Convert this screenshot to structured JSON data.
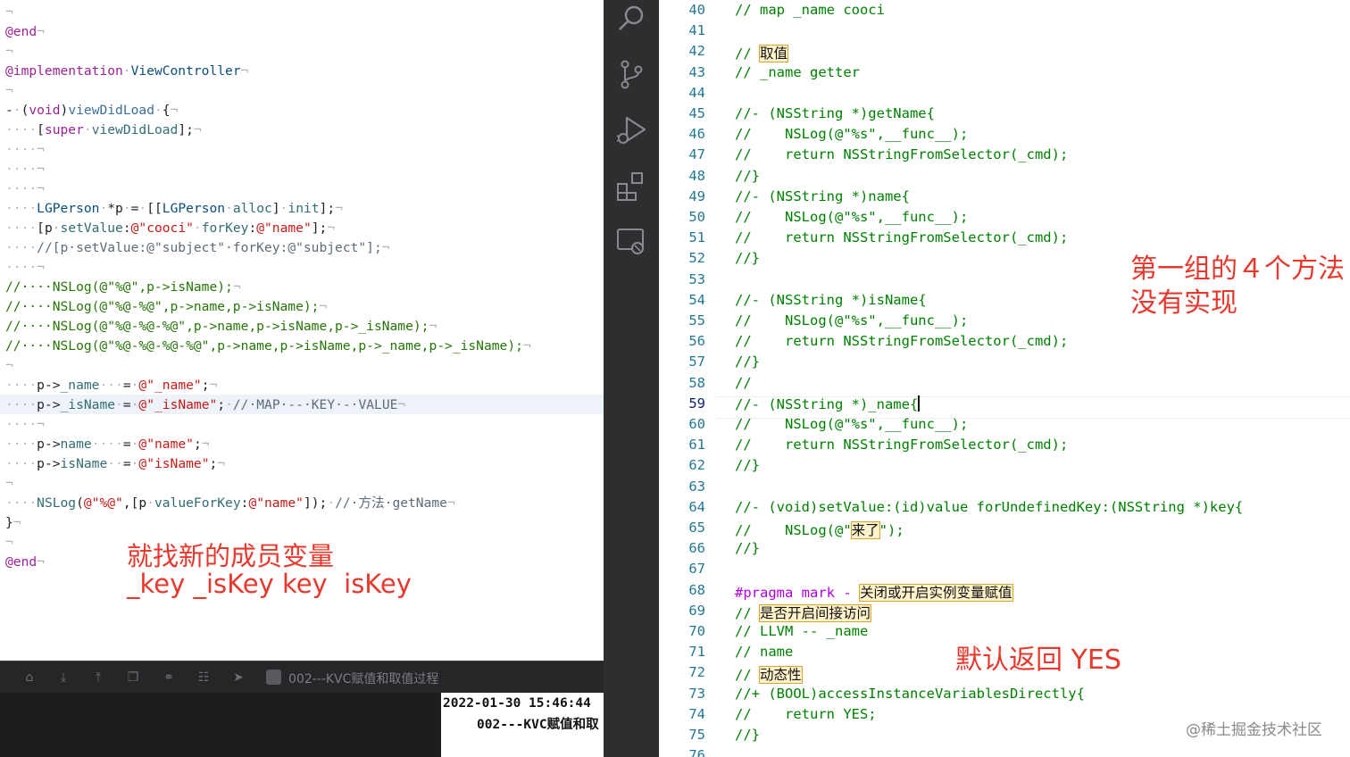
{
  "left_editor": {
    "lines": [
      {
        "segments": [
          {
            "t": "¬",
            "c": "t-inv"
          }
        ]
      },
      {
        "segments": [
          {
            "t": "@end",
            "c": "t-kw"
          },
          {
            "t": "¬",
            "c": "t-inv"
          }
        ]
      },
      {
        "segments": [
          {
            "t": "¬",
            "c": "t-inv"
          }
        ]
      },
      {
        "segments": [
          {
            "t": "@implementation",
            "c": "t-kw"
          },
          {
            "t": "·",
            "c": "t-inv"
          },
          {
            "t": "ViewController",
            "c": "t-ty"
          },
          {
            "t": "¬",
            "c": "t-inv"
          }
        ]
      },
      {
        "segments": [
          {
            "t": "¬",
            "c": "t-inv"
          }
        ]
      },
      {
        "segments": [
          {
            "t": "-",
            "c": ""
          },
          {
            "t": "·",
            "c": "t-inv"
          },
          {
            "t": "(",
            "c": ""
          },
          {
            "t": "void",
            "c": "t-kw"
          },
          {
            "t": ")",
            "c": ""
          },
          {
            "t": "viewDidLoad",
            "c": "t-fn"
          },
          {
            "t": "·",
            "c": "t-inv"
          },
          {
            "t": "{",
            "c": ""
          },
          {
            "t": "¬",
            "c": "t-inv"
          }
        ]
      },
      {
        "segments": [
          {
            "t": "····",
            "c": "t-inv"
          },
          {
            "t": "[",
            "c": ""
          },
          {
            "t": "super",
            "c": "t-kw"
          },
          {
            "t": "·",
            "c": "t-inv"
          },
          {
            "t": "viewDidLoad",
            "c": "t-ac"
          },
          {
            "t": "];",
            "c": ""
          },
          {
            "t": "¬",
            "c": "t-inv"
          }
        ]
      },
      {
        "segments": [
          {
            "t": "····¬",
            "c": "t-inv"
          }
        ]
      },
      {
        "segments": [
          {
            "t": "····¬",
            "c": "t-inv"
          }
        ]
      },
      {
        "segments": [
          {
            "t": "····¬",
            "c": "t-inv"
          }
        ]
      },
      {
        "segments": [
          {
            "t": "····",
            "c": "t-inv"
          },
          {
            "t": "LGPerson",
            "c": "t-ty"
          },
          {
            "t": "·",
            "c": "t-inv"
          },
          {
            "t": "*p",
            "c": ""
          },
          {
            "t": "·",
            "c": "t-inv"
          },
          {
            "t": "=",
            "c": ""
          },
          {
            "t": "·",
            "c": "t-inv"
          },
          {
            "t": "[[",
            "c": ""
          },
          {
            "t": "LGPerson",
            "c": "t-ty"
          },
          {
            "t": "·",
            "c": "t-inv"
          },
          {
            "t": "alloc",
            "c": "t-ac"
          },
          {
            "t": "]",
            "c": ""
          },
          {
            "t": "·",
            "c": "t-inv"
          },
          {
            "t": "init",
            "c": "t-ac"
          },
          {
            "t": "];",
            "c": ""
          },
          {
            "t": "¬",
            "c": "t-inv"
          }
        ]
      },
      {
        "segments": [
          {
            "t": "····",
            "c": "t-inv"
          },
          {
            "t": "[p",
            "c": ""
          },
          {
            "t": "·",
            "c": "t-inv"
          },
          {
            "t": "setValue",
            "c": "t-ac"
          },
          {
            "t": ":",
            "c": ""
          },
          {
            "t": "@\"cooci\"",
            "c": "t-str"
          },
          {
            "t": "·",
            "c": "t-inv"
          },
          {
            "t": "forKey",
            "c": "t-ac"
          },
          {
            "t": ":",
            "c": ""
          },
          {
            "t": "@\"name\"",
            "c": "t-str"
          },
          {
            "t": "];",
            "c": ""
          },
          {
            "t": "¬",
            "c": "t-inv"
          }
        ]
      },
      {
        "segments": [
          {
            "t": "····",
            "c": "t-inv"
          },
          {
            "t": "//[p·setValue:@\"subject\"·forKey:@\"subject\"];",
            "c": "t-cm"
          },
          {
            "t": "¬",
            "c": "t-inv"
          }
        ]
      },
      {
        "segments": [
          {
            "t": "····¬",
            "c": "t-inv"
          }
        ]
      },
      {
        "segments": [
          {
            "t": "//····NSLog(@\"%@\",p->isName);",
            "c": "t-cmg"
          },
          {
            "t": "¬",
            "c": "t-inv"
          }
        ]
      },
      {
        "segments": [
          {
            "t": "//····NSLog(@\"%@-%@\",p->name,p->isName);",
            "c": "t-cmg"
          },
          {
            "t": "¬",
            "c": "t-inv"
          }
        ]
      },
      {
        "segments": [
          {
            "t": "//····NSLog(@\"%@-%@-%@\",p->name,p->isName,p->_isName);",
            "c": "t-cmg"
          },
          {
            "t": "¬",
            "c": "t-inv"
          }
        ]
      },
      {
        "segments": [
          {
            "t": "//····NSLog(@\"%@-%@-%@-%@\",p->name,p->isName,p->_name,p->_isName);",
            "c": "t-cmg"
          },
          {
            "t": "¬",
            "c": "t-inv"
          }
        ]
      },
      {
        "segments": [
          {
            "t": "¬",
            "c": "t-inv"
          }
        ]
      },
      {
        "segments": [
          {
            "t": "····",
            "c": "t-inv"
          },
          {
            "t": "p->",
            "c": ""
          },
          {
            "t": "_name",
            "c": "t-ac"
          },
          {
            "t": "···",
            "c": "t-inv"
          },
          {
            "t": "=",
            "c": ""
          },
          {
            "t": "·",
            "c": "t-inv"
          },
          {
            "t": "@\"_name\"",
            "c": "t-str"
          },
          {
            "t": ";",
            "c": ""
          },
          {
            "t": "¬",
            "c": "t-inv"
          }
        ]
      },
      {
        "segments": [
          {
            "t": "····",
            "c": "t-inv"
          },
          {
            "t": "p->",
            "c": ""
          },
          {
            "t": "_isName",
            "c": "t-ac"
          },
          {
            "t": "·",
            "c": "t-inv"
          },
          {
            "t": "=",
            "c": ""
          },
          {
            "t": "·",
            "c": "t-inv"
          },
          {
            "t": "@\"_isName\"",
            "c": "t-str"
          },
          {
            "t": ";",
            "c": ""
          },
          {
            "t": "·",
            "c": "t-inv"
          },
          {
            "t": "//·MAP·--·KEY·-·VALUE",
            "c": "t-cm"
          },
          {
            "t": "¬",
            "c": "t-inv"
          }
        ]
      },
      {
        "segments": [
          {
            "t": "····¬",
            "c": "t-inv"
          }
        ]
      },
      {
        "segments": [
          {
            "t": "····",
            "c": "t-inv"
          },
          {
            "t": "p->",
            "c": ""
          },
          {
            "t": "name",
            "c": "t-ac"
          },
          {
            "t": "····",
            "c": "t-inv"
          },
          {
            "t": "=",
            "c": ""
          },
          {
            "t": "·",
            "c": "t-inv"
          },
          {
            "t": "@\"name\"",
            "c": "t-str"
          },
          {
            "t": ";",
            "c": ""
          },
          {
            "t": "¬",
            "c": "t-inv"
          }
        ]
      },
      {
        "segments": [
          {
            "t": "····",
            "c": "t-inv"
          },
          {
            "t": "p->",
            "c": ""
          },
          {
            "t": "isName",
            "c": "t-ac"
          },
          {
            "t": "··",
            "c": "t-inv"
          },
          {
            "t": "=",
            "c": ""
          },
          {
            "t": "·",
            "c": "t-inv"
          },
          {
            "t": "@\"isName\"",
            "c": "t-str"
          },
          {
            "t": ";",
            "c": ""
          },
          {
            "t": "¬",
            "c": "t-inv"
          }
        ]
      },
      {
        "segments": [
          {
            "t": "¬",
            "c": "t-inv"
          }
        ]
      },
      {
        "segments": [
          {
            "t": "····",
            "c": "t-inv"
          },
          {
            "t": "NSLog",
            "c": "t-ac"
          },
          {
            "t": "(",
            "c": ""
          },
          {
            "t": "@\"%@\"",
            "c": "t-str"
          },
          {
            "t": ",[p",
            "c": ""
          },
          {
            "t": "·",
            "c": "t-inv"
          },
          {
            "t": "valueForKey",
            "c": "t-ac"
          },
          {
            "t": ":",
            "c": ""
          },
          {
            "t": "@\"name\"",
            "c": "t-str"
          },
          {
            "t": "]);",
            "c": ""
          },
          {
            "t": "·",
            "c": "t-inv"
          },
          {
            "t": "//·方法·getName",
            "c": "t-cm"
          },
          {
            "t": "¬",
            "c": "t-inv"
          }
        ]
      },
      {
        "segments": [
          {
            "t": "}",
            "c": ""
          },
          {
            "t": "¬",
            "c": "t-inv"
          }
        ]
      },
      {
        "segments": [
          {
            "t": "¬",
            "c": "t-inv"
          }
        ]
      },
      {
        "segments": [
          {
            "t": "@end",
            "c": "t-kw"
          },
          {
            "t": "¬",
            "c": "t-inv"
          }
        ]
      }
    ],
    "annotation": {
      "line1": "就找新的成员变量",
      "line2": "_key _isKey key  isKey"
    }
  },
  "debug_toolbar": {
    "title": "002---KVC赋值和取值过程",
    "buttons": [
      "hide-debug-area-icon",
      "step-over-icon",
      "step-into-icon",
      "step-out-icon",
      "debug-view-hierarchy-icon",
      "memory-graph-icon",
      "environment-overrides-icon",
      "simulate-location-icon"
    ]
  },
  "console": {
    "line1": "2022-01-30 15:46:44",
    "line2": "002---KVC赋值和取"
  },
  "activity_bar": {
    "icons": [
      "search-icon",
      "source-control-icon",
      "run-debug-icon",
      "extensions-icon",
      "remote-explorer-icon"
    ]
  },
  "right_editor": {
    "current_line": 59,
    "lines": [
      {
        "n": 40,
        "segments": [
          {
            "t": "// map _name cooci"
          }
        ]
      },
      {
        "n": 41,
        "segments": []
      },
      {
        "n": 42,
        "segments": [
          {
            "t": "// "
          },
          {
            "t": "取值",
            "c": "box"
          }
        ]
      },
      {
        "n": 43,
        "segments": [
          {
            "t": "// _name getter"
          }
        ]
      },
      {
        "n": 44,
        "segments": []
      },
      {
        "n": 45,
        "segments": [
          {
            "t": "//- (NSString *)getName{"
          }
        ]
      },
      {
        "n": 46,
        "segments": [
          {
            "t": "//    NSLog(@\"%s\",__func__);"
          }
        ]
      },
      {
        "n": 47,
        "segments": [
          {
            "t": "//    return NSStringFromSelector(_cmd);"
          }
        ]
      },
      {
        "n": 48,
        "segments": [
          {
            "t": "//}"
          }
        ]
      },
      {
        "n": 49,
        "segments": [
          {
            "t": "//- (NSString *)name{"
          }
        ]
      },
      {
        "n": 50,
        "segments": [
          {
            "t": "//    NSLog(@\"%s\",__func__);"
          }
        ]
      },
      {
        "n": 51,
        "segments": [
          {
            "t": "//    return NSStringFromSelector(_cmd);"
          }
        ]
      },
      {
        "n": 52,
        "segments": [
          {
            "t": "//}"
          }
        ]
      },
      {
        "n": 53,
        "segments": []
      },
      {
        "n": 54,
        "segments": [
          {
            "t": "//- (NSString *)isName{"
          }
        ]
      },
      {
        "n": 55,
        "segments": [
          {
            "t": "//    NSLog(@\"%s\",__func__);"
          }
        ]
      },
      {
        "n": 56,
        "segments": [
          {
            "t": "//    return NSStringFromSelector(_cmd);"
          }
        ]
      },
      {
        "n": 57,
        "segments": [
          {
            "t": "//}"
          }
        ]
      },
      {
        "n": 58,
        "segments": [
          {
            "t": "//"
          }
        ]
      },
      {
        "n": 59,
        "segments": [
          {
            "t": "//- (NSString *)_name{"
          }
        ]
      },
      {
        "n": 60,
        "segments": [
          {
            "t": "//    NSLog(@\"%s\",__func__);"
          }
        ]
      },
      {
        "n": 61,
        "segments": [
          {
            "t": "//    return NSStringFromSelector(_cmd);"
          }
        ]
      },
      {
        "n": 62,
        "segments": [
          {
            "t": "//}"
          }
        ]
      },
      {
        "n": 63,
        "segments": []
      },
      {
        "n": 64,
        "segments": [
          {
            "t": "//- (void)setValue:(id)value forUndefinedKey:(NSString *)key{"
          }
        ]
      },
      {
        "n": 65,
        "segments": [
          {
            "t": "//    NSLog(@\""
          },
          {
            "t": "来了",
            "c": "box"
          },
          {
            "t": "\");"
          }
        ]
      },
      {
        "n": 66,
        "segments": [
          {
            "t": "//}"
          }
        ]
      },
      {
        "n": 67,
        "segments": []
      },
      {
        "n": 68,
        "segments": [
          {
            "t": "#pragma mark - ",
            "c": "pp"
          },
          {
            "t": "关闭或开启实例变量赋值",
            "c": "box"
          }
        ]
      },
      {
        "n": 69,
        "segments": [
          {
            "t": "// "
          },
          {
            "t": "是否开启间接访问",
            "c": "box"
          }
        ]
      },
      {
        "n": 70,
        "segments": [
          {
            "t": "// LLVM -- _name"
          }
        ]
      },
      {
        "n": 71,
        "segments": [
          {
            "t": "// name"
          }
        ]
      },
      {
        "n": 72,
        "segments": [
          {
            "t": "// "
          },
          {
            "t": "动态性",
            "c": "box"
          }
        ]
      },
      {
        "n": 73,
        "segments": [
          {
            "t": "//+ (BOOL)accessInstanceVariablesDirectly{"
          }
        ]
      },
      {
        "n": 74,
        "segments": [
          {
            "t": "//    return YES;"
          }
        ]
      },
      {
        "n": 75,
        "segments": [
          {
            "t": "//}"
          }
        ]
      },
      {
        "n": 76,
        "segments": []
      }
    ],
    "annotation_top": {
      "line1": "第一组的４个方法",
      "line2": "没有实现"
    },
    "annotation_bottom": "默认返回 YES",
    "watermark": "@稀土掘金技术社区"
  },
  "colors": {
    "annotation_red": "#e6382c",
    "comment_green": "#008000",
    "highlight_box": "#fff3cc"
  }
}
